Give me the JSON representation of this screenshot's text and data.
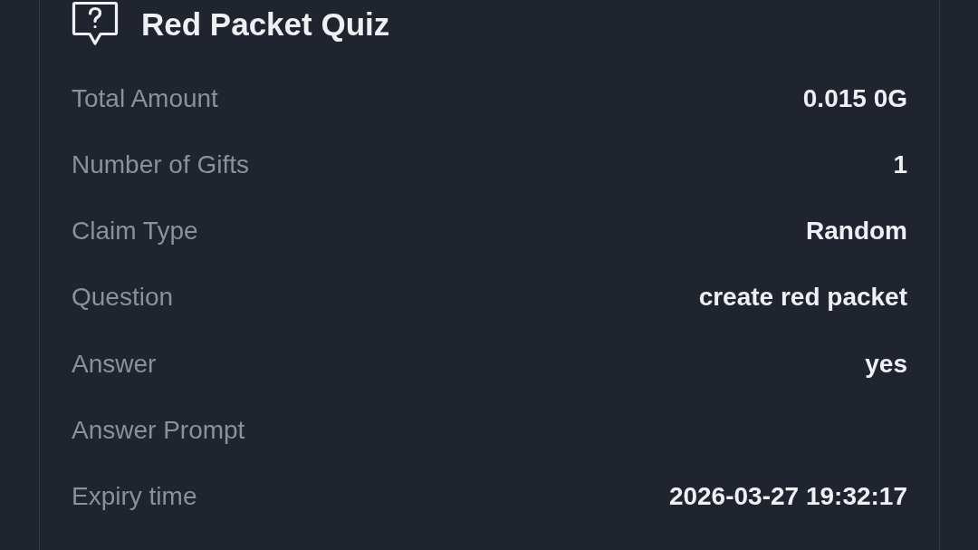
{
  "card": {
    "title": "Red Packet Quiz",
    "rows": [
      {
        "label": "Total Amount",
        "value": "0.015 0G"
      },
      {
        "label": "Number of Gifts",
        "value": "1"
      },
      {
        "label": "Claim Type",
        "value": "Random"
      },
      {
        "label": "Question",
        "value": "create red packet"
      },
      {
        "label": "Answer",
        "value": "yes"
      },
      {
        "label": "Answer Prompt"
      },
      {
        "label": "Expiry time",
        "value": "2026-03-27 19:32:17"
      }
    ]
  }
}
